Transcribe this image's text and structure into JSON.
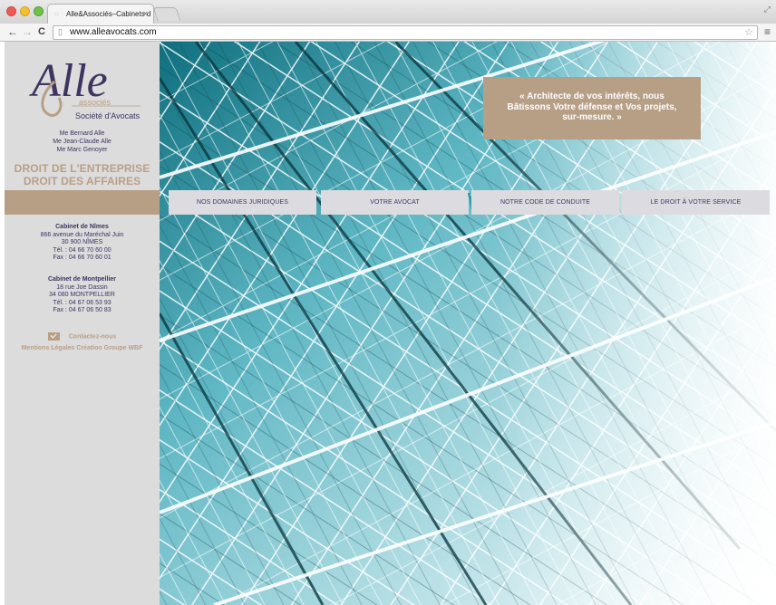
{
  "browser": {
    "tab_title": "Alle&Associés–Cabinets d",
    "tab_close": "×",
    "url": "www.alleavocats.com"
  },
  "sidebar": {
    "logo_text": "Alle",
    "logo_sub1": "associés",
    "logo_sub2": "Société d'Avocats",
    "partners": [
      "Me Bernard Alle",
      "Me Jean-Claude Alle",
      "Me Marc Genoyer"
    ],
    "tagline": [
      "DROIT DE L'ENTREPRISE",
      "DROIT DES AFFAIRES"
    ],
    "offices": [
      {
        "title": "Cabinet de Nîmes",
        "lines": [
          "866 avenue du Maréchal Juin",
          "30 900 NÎMES",
          "Tél. : 04 66 70 60 00",
          "Fax : 04 66 70 60 01"
        ]
      },
      {
        "title": "Cabinet de Montpellier",
        "lines": [
          "18 rue Joe Dassin",
          "34 080 MONTPELLIER",
          "Tél. : 04 67 06 53 93",
          "Fax : 04 67 06 50 83"
        ]
      }
    ],
    "contact_label": "Contactez-nous",
    "legal_label": "Mentions Légales",
    "credit_label": "Création Groupe WBF"
  },
  "hero": {
    "quote_lines": [
      "« Architecte de vos intérêts, nous",
      "Bâtissons Votre défense et Vos projets,",
      "sur-mesure. »"
    ]
  },
  "nav": {
    "items": [
      "NOS DOMAINES JURIDIQUES",
      "VOTRE AVOCAT",
      "NOTRE CODE DE CONDUITE",
      "LE DROIT À VOTRE SERVICE"
    ]
  },
  "colors": {
    "brand_tan": "#b79f86",
    "brand_navy": "#3e3460",
    "sidebar_bg": "#dcdcdc",
    "accent_teal": "#2aa0a8"
  },
  "icons": {
    "back": "arrow-left-icon",
    "forward": "arrow-right-icon",
    "reload": "reload-icon",
    "bookmark": "star-icon",
    "menu": "hamburger-menu-icon",
    "contact": "mail-icon"
  }
}
